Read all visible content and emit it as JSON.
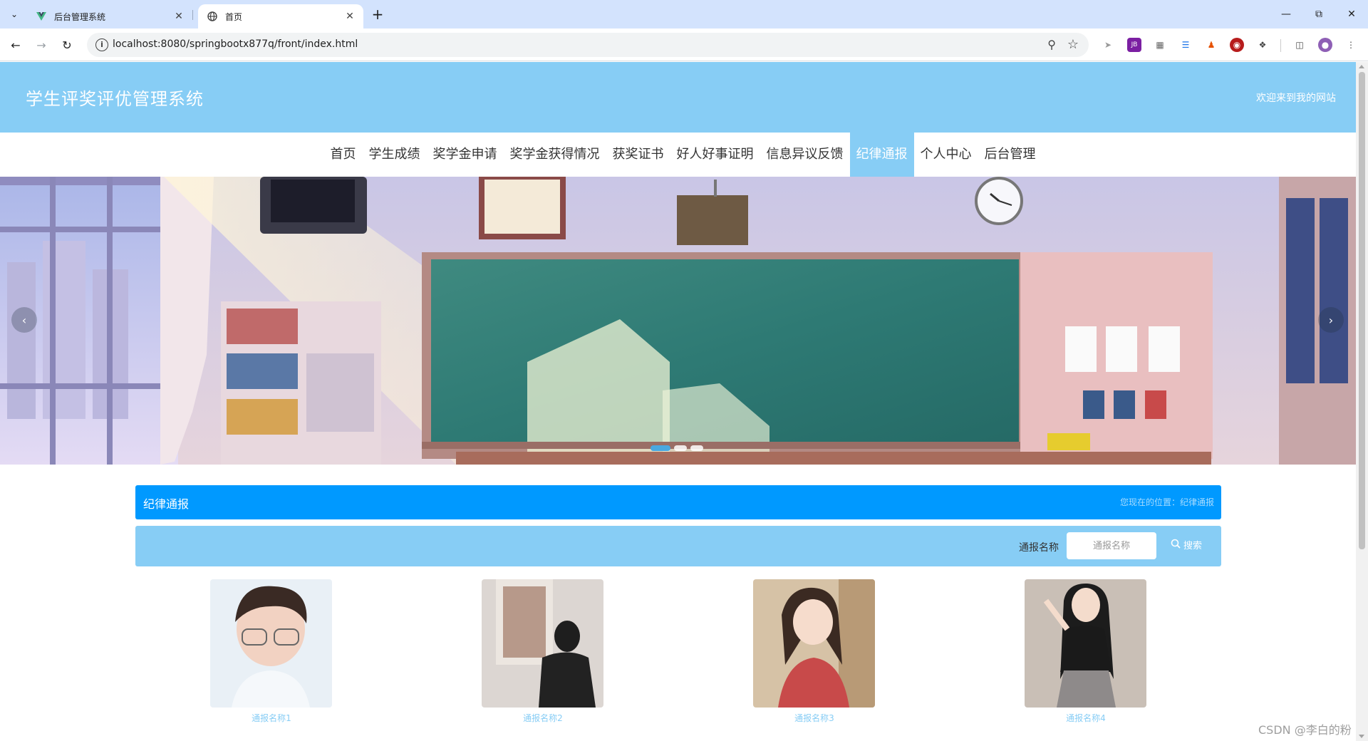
{
  "browser": {
    "tabs": [
      {
        "title": "后台管理系统",
        "favicon": "vue-logo-icon"
      },
      {
        "title": "首页",
        "favicon": "globe-icon"
      }
    ],
    "url": "localhost:8080/springbootx877q/front/index.html"
  },
  "site": {
    "title": "学生评奖评优管理系统",
    "welcome": "欢迎来到我的网站"
  },
  "nav": {
    "items": [
      {
        "label": "首页"
      },
      {
        "label": "学生成绩"
      },
      {
        "label": "奖学金申请"
      },
      {
        "label": "奖学金获得情况"
      },
      {
        "label": "获奖证书"
      },
      {
        "label": "好人好事证明"
      },
      {
        "label": "信息异议反馈"
      },
      {
        "label": "纪律通报"
      },
      {
        "label": "个人中心"
      },
      {
        "label": "后台管理"
      }
    ],
    "active_index": 7
  },
  "carousel": {
    "slide_count": 3,
    "active_slide": 1
  },
  "section": {
    "title": "纪律通报",
    "breadcrumb": "您现在的位置：纪律通报"
  },
  "search": {
    "label": "通报名称",
    "placeholder": "通报名称",
    "button_label": "搜索"
  },
  "cards": [
    {
      "name": "通报名称1"
    },
    {
      "name": "通报名称2"
    },
    {
      "name": "通报名称3"
    },
    {
      "name": "通报名称4"
    }
  ],
  "watermark": "CSDN @李白的粉",
  "colors": {
    "header_bg": "#87cdf5",
    "section_bar": "#0099ff",
    "card_name": "#87cdf5"
  }
}
